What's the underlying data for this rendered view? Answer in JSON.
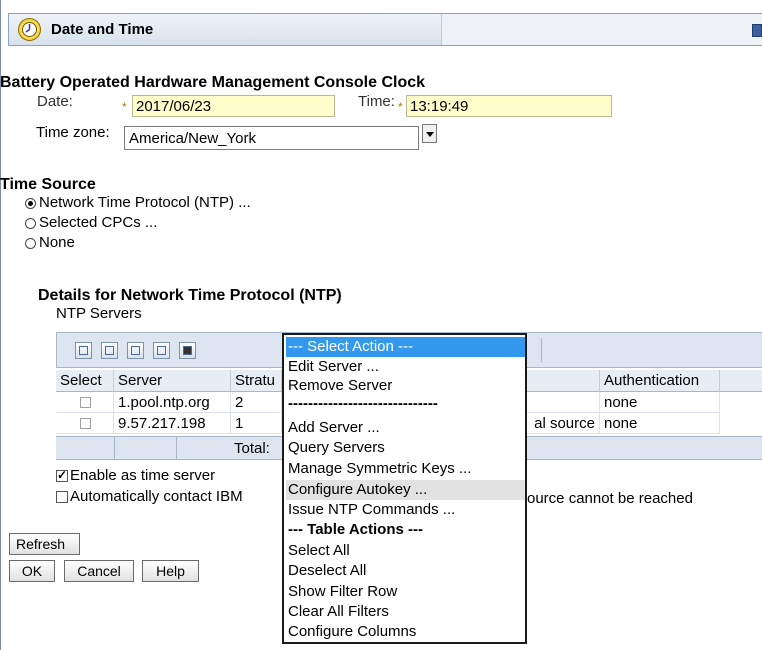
{
  "header": {
    "title": "Date and Time",
    "info_icon": "info-icon"
  },
  "clock": {
    "section_title": "Battery Operated Hardware Management Console Clock",
    "date_label": "Date:",
    "date_value": "2017/06/23",
    "time_label": "Time:",
    "time_value": "13:19:49",
    "required_marker": "*",
    "timezone_label": "Time zone:",
    "timezone_value": "America/New_York"
  },
  "time_source": {
    "title": "Time Source",
    "options": [
      "Network Time Protocol (NTP) ...",
      "Selected CPCs ...",
      "None"
    ],
    "selected_index": 0
  },
  "ntp": {
    "details_title": "Details for Network Time Protocol (NTP)",
    "servers_label": "NTP Servers",
    "columns": [
      "Select",
      "Server",
      "Stratu",
      "Authentication"
    ],
    "rows": [
      {
        "server": "1.pool.ntp.org",
        "stratum": "2",
        "source": "",
        "auth": "none"
      },
      {
        "server": "9.57.217.198",
        "stratum": "1",
        "source": "al source",
        "auth": "none"
      }
    ],
    "total_label": "Total:",
    "enable_label": "Enable as time server",
    "enable_checked": true,
    "auto_contact_label": "Automatically contact IBM",
    "auto_contact_tail": "ource cannot be reached",
    "auto_contact_checked": false
  },
  "buttons": {
    "refresh": "Refresh",
    "ok": "OK",
    "cancel": "Cancel",
    "help": "Help"
  },
  "action_menu": {
    "items": [
      "--- Select Action ---",
      "Edit Server ...",
      "Remove Server",
      "------------------------------",
      "Add Server ...",
      "Query Servers",
      "Manage Symmetric Keys ...",
      "Configure Autokey ...",
      "Issue NTP Commands ...",
      "--- Table Actions ---",
      "Select All",
      "Deselect All",
      "Show Filter Row",
      "Clear All Filters",
      "Configure Columns"
    ],
    "selected_index": 0,
    "hover_index": 7
  },
  "colors": {
    "menu_selected": "#3399ee",
    "input_bg": "#ffffcc",
    "header_bg": "#dde6f0"
  }
}
